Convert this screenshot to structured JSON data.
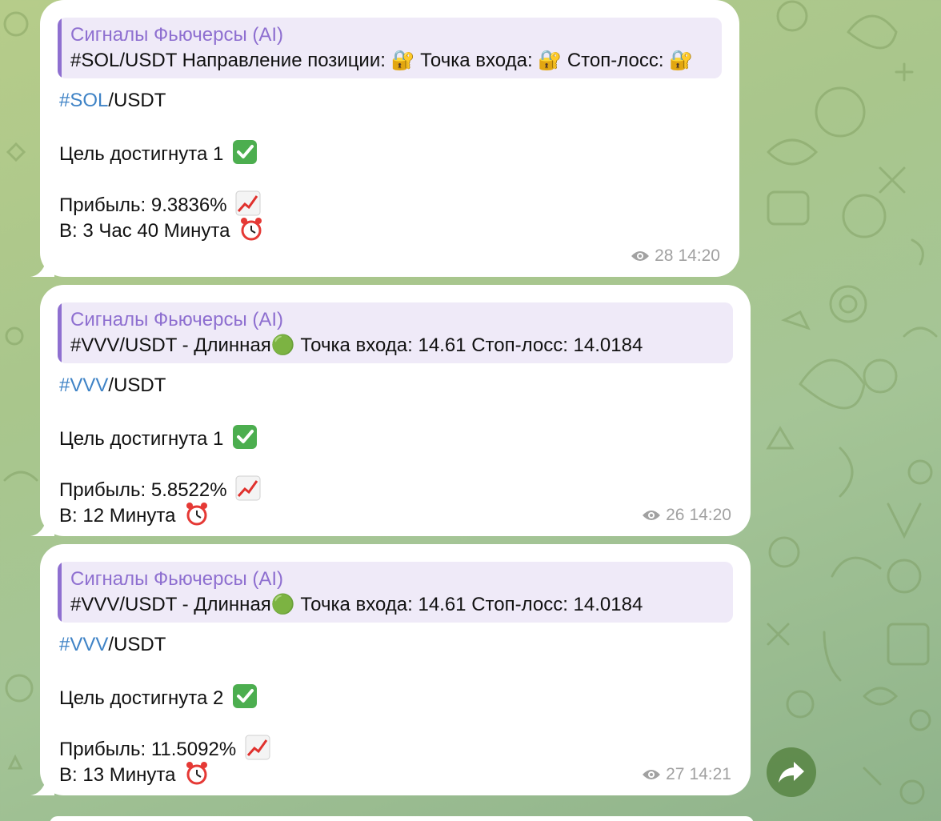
{
  "colors": {
    "accent_purple": "#8e6fd0",
    "hashtag_blue": "#3f83c6",
    "meta_gray": "#a1a1a1",
    "share_green": "#52803c"
  },
  "messages": [
    {
      "reply_title": "Сигналы Фьючерсы (AI)",
      "reply_text": "#SOL/USDT Направление позиции: 🔐 Точка входа: 🔐 Стоп-лосс: 🔐",
      "hashtag": "#SOL",
      "pair_suffix": "/USDT",
      "target_text": "Цель достигнута 1",
      "profit_text": "Прибыль: 9.3836%",
      "time_text": "В: 3 Час 40 Минута",
      "views": "28",
      "time": "14:20"
    },
    {
      "reply_title": "Сигналы Фьючерсы (AI)",
      "reply_text": "#VVV/USDT - Длинная🟢  Точка входа: 14.61 Стоп-лосс: 14.0184",
      "hashtag": "#VVV",
      "pair_suffix": "/USDT",
      "target_text": "Цель достигнута 1",
      "profit_text": "Прибыль: 5.8522%",
      "time_text": "В: 12 Минута",
      "views": "26",
      "time": "14:20"
    },
    {
      "reply_title": "Сигналы Фьючерсы (AI)",
      "reply_text": "#VVV/USDT - Длинная🟢  Точка входа: 14.61 Стоп-лосс: 14.0184",
      "hashtag": "#VVV",
      "pair_suffix": "/USDT",
      "target_text": "Цель достигнута 2",
      "profit_text": "Прибыль: 11.5092%",
      "time_text": "В: 13 Минута",
      "views": "27",
      "time": "14:21"
    }
  ],
  "icons": {
    "check": "white-check-mark-icon",
    "chart": "chart-increasing-icon",
    "alarm": "alarm-clock-icon",
    "eye": "eye-icon",
    "share": "share-arrow-icon"
  }
}
